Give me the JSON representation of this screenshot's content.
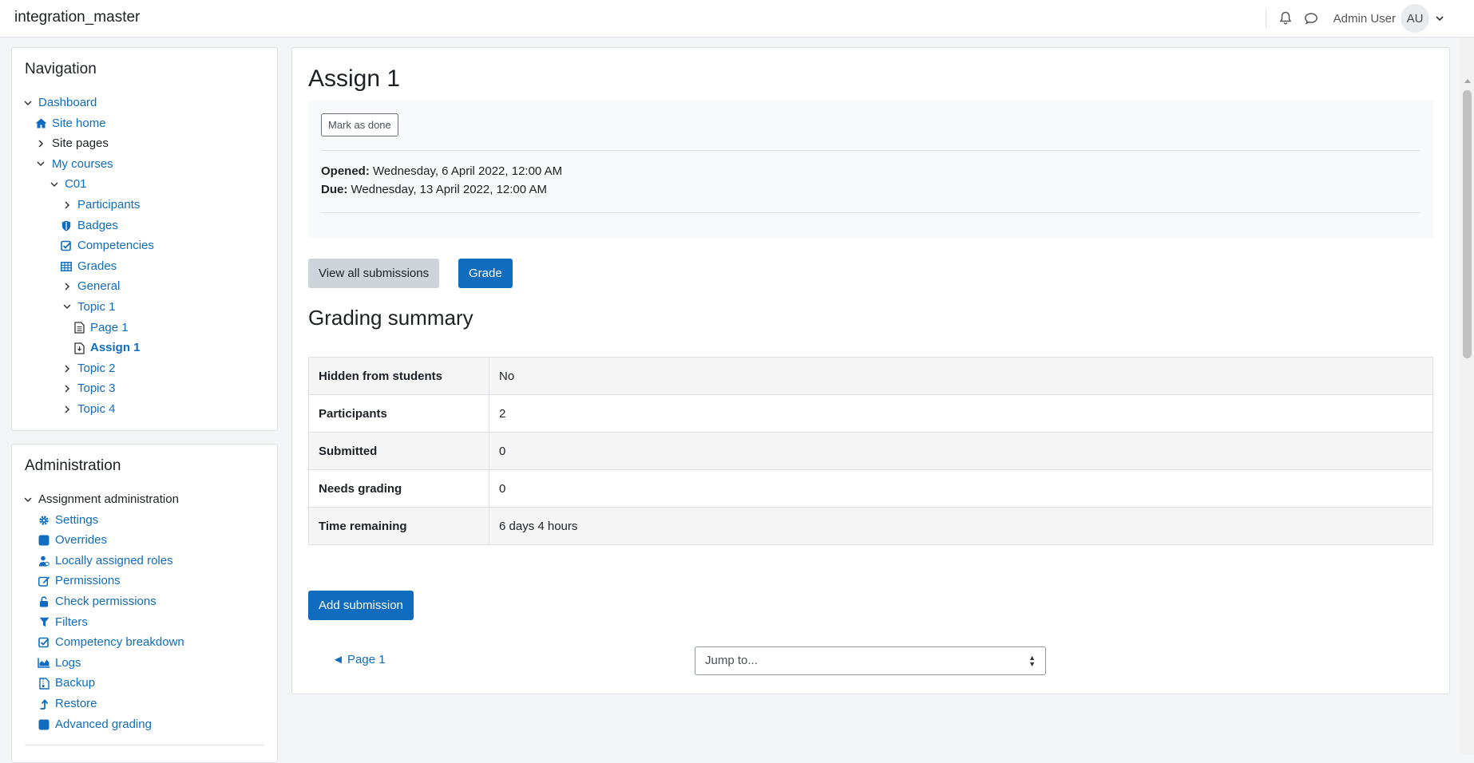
{
  "header": {
    "site_name": "integration_master",
    "user_name": "Admin User",
    "user_initials": "AU",
    "icons": [
      "bell-icon",
      "chat-icon",
      "chevron-down-icon"
    ]
  },
  "navigation": {
    "title": "Navigation",
    "items": [
      {
        "label": "Dashboard"
      },
      {
        "label": "Site home"
      },
      {
        "label": "Site pages"
      },
      {
        "label": "My courses"
      },
      {
        "label": "C01"
      },
      {
        "label": "Participants"
      },
      {
        "label": "Badges"
      },
      {
        "label": "Competencies"
      },
      {
        "label": "Grades"
      },
      {
        "label": "General"
      },
      {
        "label": "Topic 1"
      },
      {
        "label": "Page 1"
      },
      {
        "label": "Assign 1"
      },
      {
        "label": "Topic 2"
      },
      {
        "label": "Topic 3"
      },
      {
        "label": "Topic 4"
      }
    ]
  },
  "administration": {
    "title": "Administration",
    "items": [
      {
        "label": "Assignment administration"
      },
      {
        "label": "Settings"
      },
      {
        "label": "Overrides"
      },
      {
        "label": "Locally assigned roles"
      },
      {
        "label": "Permissions"
      },
      {
        "label": "Check permissions"
      },
      {
        "label": "Filters"
      },
      {
        "label": "Competency breakdown"
      },
      {
        "label": "Logs"
      },
      {
        "label": "Backup"
      },
      {
        "label": "Restore"
      },
      {
        "label": "Advanced grading"
      }
    ]
  },
  "main": {
    "title": "Assign 1",
    "mark_done_label": "Mark as done",
    "opened_label": "Opened:",
    "opened_value": "Wednesday, 6 April 2022, 12:00 AM",
    "due_label": "Due:",
    "due_value": "Wednesday, 13 April 2022, 12:00 AM",
    "view_all_label": "View all submissions",
    "grade_label": "Grade",
    "summary_title": "Grading summary",
    "summary_rows": [
      {
        "key": "Hidden from students",
        "value": "No"
      },
      {
        "key": "Participants",
        "value": "2"
      },
      {
        "key": "Submitted",
        "value": "0"
      },
      {
        "key": "Needs grading",
        "value": "0"
      },
      {
        "key": "Time remaining",
        "value": "6 days 4 hours"
      }
    ],
    "add_submission_label": "Add submission",
    "prev_link_label": "◄ Page 1",
    "jump_placeholder": "Jump to..."
  },
  "colors": {
    "link": "#0f6cbf",
    "primary_button": "#0f6cbf",
    "secondary_button": "#ced4da"
  }
}
